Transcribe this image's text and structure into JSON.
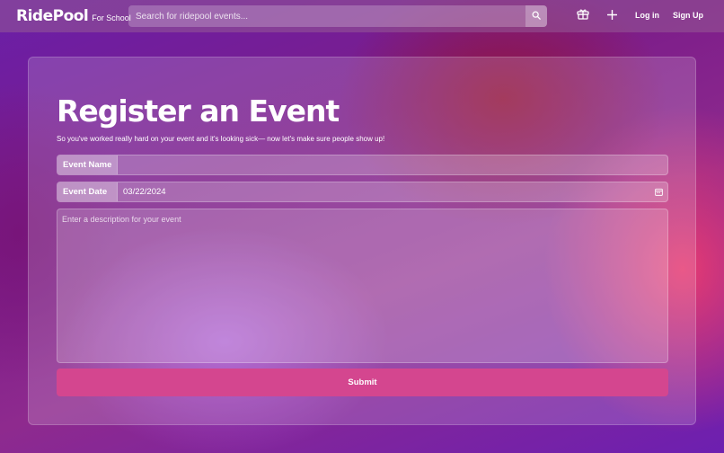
{
  "header": {
    "brand": "RidePool",
    "brand_sub": "For School",
    "search": {
      "placeholder": "Search for ridepool events..."
    },
    "icons": [
      "search-icon",
      "gift-icon",
      "plus-icon"
    ],
    "login_label": "Log in",
    "signup_label": "Sign Up"
  },
  "form": {
    "title": "Register an Event",
    "subtitle": "So you've worked really hard on your event and it's looking sick— now let's make sure people show up!",
    "event_name": {
      "label": "Event Name",
      "value": ""
    },
    "event_date": {
      "label": "Event Date",
      "value": "03/22/2024"
    },
    "description": {
      "placeholder": "Enter a description for your event",
      "value": ""
    },
    "submit_label": "Submit"
  },
  "colors": {
    "accent": "#d4468f",
    "background_primary": "#6a1fa8",
    "background_secondary": "#f03c6e"
  }
}
